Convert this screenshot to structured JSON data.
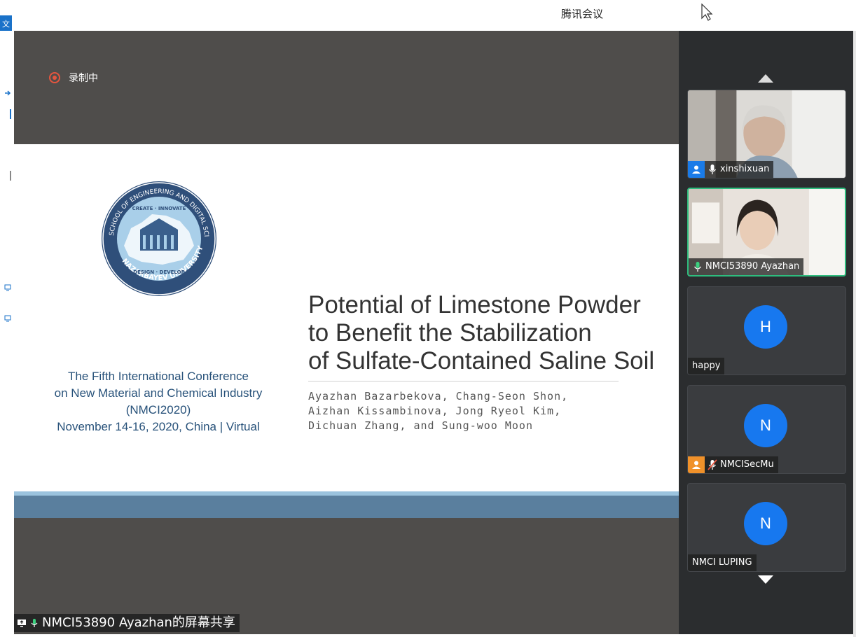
{
  "window": {
    "app_title": "腾讯会议",
    "left_tab_label": "文件"
  },
  "recording": {
    "label": "录制中"
  },
  "slide": {
    "logo_text": {
      "ring_top": "SCHOOL OF ENGINEERING AND DIGITAL SCIENCES",
      "ring_bottom": "NAZARBAYEV UNIVERSITY",
      "motto_top": "CREATE · INNOVATE",
      "motto_bottom": "DESIGN · DEVELOP"
    },
    "conference": {
      "line1": "The Fifth International Conference",
      "line2": "on New Material and Chemical Industry",
      "line3": "(NMCI2020)",
      "line4": "November 14-16, 2020, China | Virtual"
    },
    "title": {
      "line1": "Potential of Limestone Powder",
      "line2": "to Benefit the Stabilization",
      "line3": "of Sulfate-Contained Saline Soil"
    },
    "authors": {
      "line1": "Ayazhan Bazarbekova, Chang-Seon Shon,",
      "line2": "Aizhan Kissambinova, Jong Ryeol Kim,",
      "line3": "Dichuan Zhang, and Sung-woo Moon"
    }
  },
  "share_caption": {
    "text": "NMCI53890 Ayazhan的屏幕共享"
  },
  "participants": [
    {
      "name": "xinshixuan",
      "role": "host",
      "type": "video"
    },
    {
      "name": "NMCI53890 Ayazhan",
      "role": "speaker",
      "type": "video",
      "active": true
    },
    {
      "name": "happy",
      "initial": "H",
      "type": "avatar"
    },
    {
      "name": "NMCISecMu",
      "initial": "N",
      "role": "cohost",
      "muted": true,
      "type": "avatar"
    },
    {
      "name": "NMCI LUPING",
      "initial": "N",
      "type": "avatar"
    }
  ],
  "colors": {
    "accent": "#1778ef",
    "active_border": "#2ebd7e",
    "recording": "#e4553f",
    "slide_band": "#5a7f9e"
  }
}
